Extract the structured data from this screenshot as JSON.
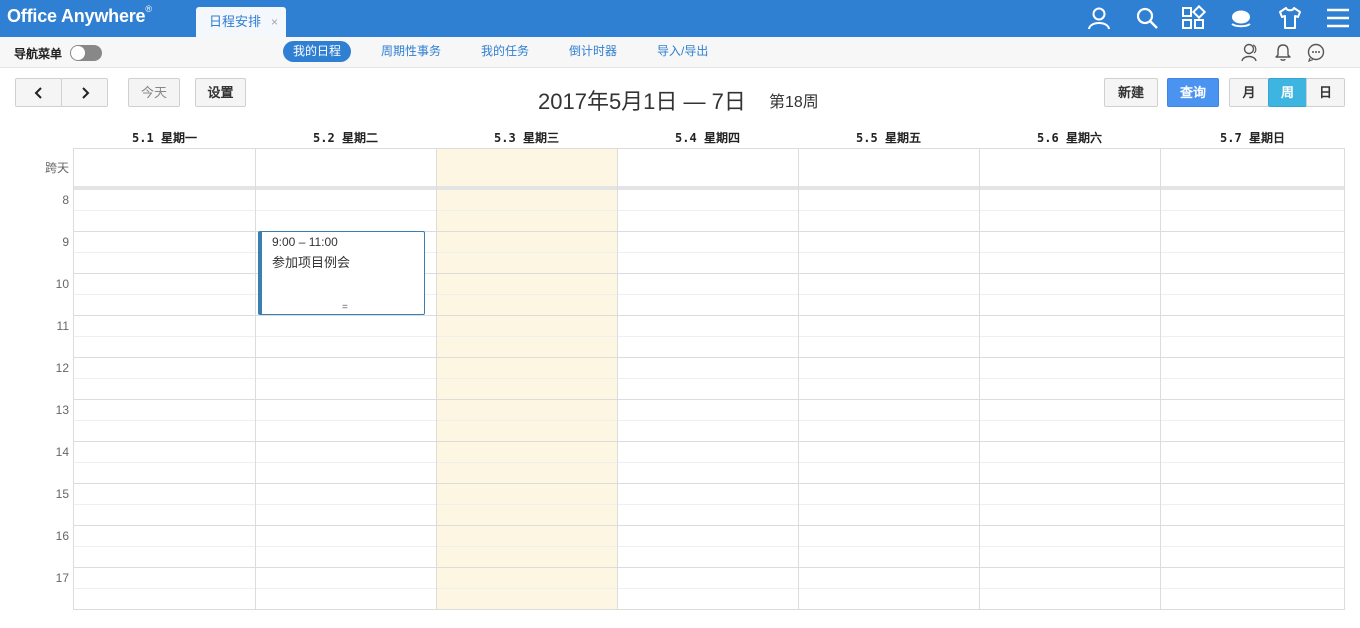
{
  "app": {
    "logo_text": "Office Anywhere",
    "logo_mark": "®",
    "tab_label": "日程安排",
    "tab_close": "×"
  },
  "header_icons": [
    "user-icon",
    "search-icon",
    "apps-icon",
    "chat-bubble-icon",
    "shirt-icon",
    "menu-icon"
  ],
  "navbar": {
    "label": "导航菜单",
    "links": [
      "我的日程",
      "周期性事务",
      "我的任务",
      "倒计时器",
      "导入/导出"
    ],
    "active_index": 0,
    "icons": [
      "contacts-icon",
      "bell-icon",
      "message-icon"
    ]
  },
  "toolbar": {
    "prev": "‹",
    "next": "›",
    "today": "今天",
    "settings": "设置",
    "title": "2017年5月1日 — 7日",
    "week": "第18周",
    "new": "新建",
    "query": "查询",
    "view_month": "月",
    "view_week": "周",
    "view_day": "日",
    "active_view": "周"
  },
  "calendar": {
    "days": [
      "5.1 星期一",
      "5.2 星期二",
      "5.3 星期三",
      "5.4 星期四",
      "5.5 星期五",
      "5.6 星期六",
      "5.7 星期日"
    ],
    "today_index": 2,
    "allday_label": "跨天",
    "hours": [
      "8",
      "9",
      "10",
      "11",
      "12",
      "13",
      "14",
      "15",
      "16",
      "17"
    ],
    "events": [
      {
        "time": "9:00 – 11:00",
        "title": "参加项目例会",
        "day_index": 1,
        "resize_handle": "="
      }
    ]
  },
  "colors": {
    "header_bg": "#2f7fd2",
    "today_bg": "#fdf6e3",
    "event_border": "#3a7fb2",
    "primary_btn": "#4b93f0",
    "active_view_btn": "#3db5e0"
  }
}
